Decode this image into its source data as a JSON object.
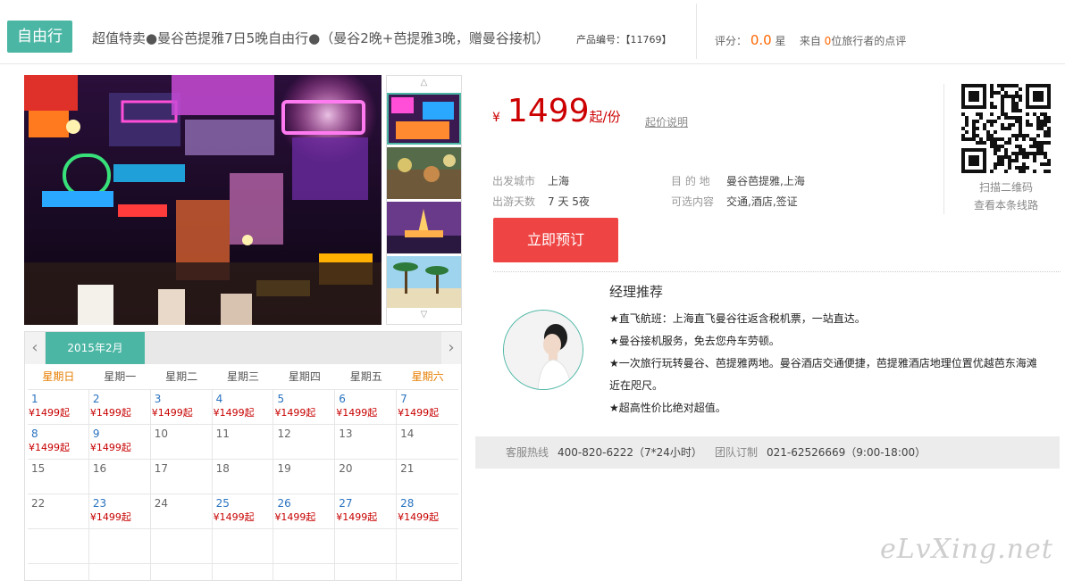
{
  "header": {
    "tag": "自由行",
    "title": "超值特卖●曼谷芭提雅7日5晚自由行●（曼谷2晚+芭提雅3晚，赠曼谷接机）",
    "product_no_label": "产品编号：",
    "product_no": "【11769】",
    "rating_label": "评分：",
    "rating_score": "0.0",
    "rating_unit": "星",
    "reviews_prefix": "来自",
    "reviews_count": "0",
    "reviews_suffix": "位旅行者的点评"
  },
  "price": {
    "currency": "¥",
    "amount": "1499",
    "unit": "起/份",
    "note": "起价说明"
  },
  "info": {
    "depart_label": "出发城市",
    "depart_value": "上海",
    "dest_label": "目 的 地",
    "dest_value": "曼谷芭提雅,上海",
    "days_label": "出游天数",
    "days_value": "7 天 5夜",
    "options_label": "可选内容",
    "options_value": "交通,酒店,签证"
  },
  "book_button": "立即预订",
  "qr": {
    "line1": "扫描二维码",
    "line2": "查看本条线路"
  },
  "manager": {
    "title": "经理推荐",
    "points": [
      "★直飞航班：上海直飞曼谷往返含税机票，一站直达。",
      "★曼谷接机服务，免去您舟车劳顿。",
      "★一次旅行玩转曼谷、芭提雅两地。曼谷酒店交通便捷，芭提雅酒店地理位置优越芭东海滩近在咫尺。",
      "★超高性价比绝对超值。"
    ]
  },
  "hotline": {
    "service_label": "客服热线",
    "service_value": "400-820-6222（7*24小时）",
    "group_label": "团队订制",
    "group_value": "021-62526669（9:00-18:00）"
  },
  "calendar": {
    "month": "2015年2月",
    "weekdays": [
      "星期日",
      "星期一",
      "星期二",
      "星期三",
      "星期四",
      "星期五",
      "星期六"
    ],
    "weeks": [
      [
        {
          "d": "1",
          "p": "¥1499起"
        },
        {
          "d": "2",
          "p": "¥1499起"
        },
        {
          "d": "3",
          "p": "¥1499起"
        },
        {
          "d": "4",
          "p": "¥1499起"
        },
        {
          "d": "5",
          "p": "¥1499起"
        },
        {
          "d": "6",
          "p": "¥1499起"
        },
        {
          "d": "7",
          "p": "¥1499起"
        }
      ],
      [
        {
          "d": "8",
          "p": "¥1499起"
        },
        {
          "d": "9",
          "p": "¥1499起"
        },
        {
          "d": "10",
          "p": ""
        },
        {
          "d": "11",
          "p": ""
        },
        {
          "d": "12",
          "p": ""
        },
        {
          "d": "13",
          "p": ""
        },
        {
          "d": "14",
          "p": ""
        }
      ],
      [
        {
          "d": "15",
          "p": ""
        },
        {
          "d": "16",
          "p": ""
        },
        {
          "d": "17",
          "p": ""
        },
        {
          "d": "18",
          "p": ""
        },
        {
          "d": "19",
          "p": ""
        },
        {
          "d": "20",
          "p": ""
        },
        {
          "d": "21",
          "p": ""
        }
      ],
      [
        {
          "d": "22",
          "p": ""
        },
        {
          "d": "23",
          "p": "¥1499起"
        },
        {
          "d": "24",
          "p": ""
        },
        {
          "d": "25",
          "p": "¥1499起"
        },
        {
          "d": "26",
          "p": "¥1499起"
        },
        {
          "d": "27",
          "p": "¥1499起"
        },
        {
          "d": "28",
          "p": "¥1499起"
        }
      ],
      [
        {
          "d": "",
          "p": ""
        },
        {
          "d": "",
          "p": ""
        },
        {
          "d": "",
          "p": ""
        },
        {
          "d": "",
          "p": ""
        },
        {
          "d": "",
          "p": ""
        },
        {
          "d": "",
          "p": ""
        },
        {
          "d": "",
          "p": ""
        }
      ],
      [
        {
          "d": "",
          "p": ""
        },
        {
          "d": "",
          "p": ""
        },
        {
          "d": "",
          "p": ""
        },
        {
          "d": "",
          "p": ""
        },
        {
          "d": "",
          "p": ""
        },
        {
          "d": "",
          "p": ""
        },
        {
          "d": "",
          "p": ""
        }
      ]
    ]
  },
  "watermark": "eLvXing.net"
}
